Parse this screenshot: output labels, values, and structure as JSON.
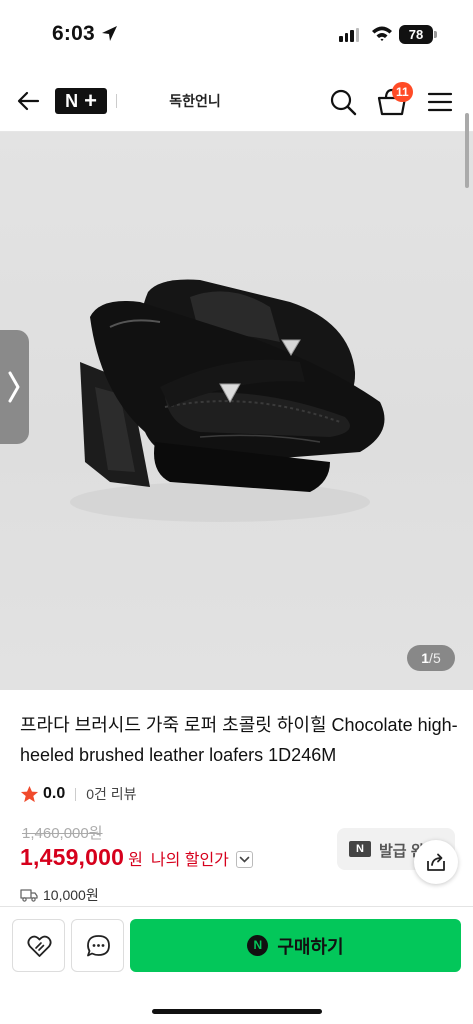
{
  "status_bar": {
    "time": "6:03",
    "battery": "78",
    "icons": [
      "location-arrow-icon",
      "signal-icon",
      "wifi-icon",
      "battery-icon"
    ]
  },
  "nav": {
    "logo": "N",
    "store_name": "독한언니",
    "cart_count": "11",
    "icons": [
      "back-arrow-icon",
      "search-icon",
      "cart-icon",
      "menu-icon"
    ]
  },
  "gallery": {
    "current": "1",
    "separator": "/",
    "total": "5"
  },
  "product": {
    "title": "프라다 브러시드 가죽 로퍼 초콜릿 하이힐 Chocolate high-heeled brushed leather loafers 1D246M",
    "rating": "0.0",
    "review_count": "0건 리뷰",
    "original_price": "1,460,000원",
    "price": "1,459,000",
    "price_unit": "원",
    "my_discount_label": "나의 할인가",
    "shipping_fee": "10,000원"
  },
  "coupon": {
    "icon_text": "N",
    "label": "발급 완료"
  },
  "bottom_bar": {
    "buy_icon": "N",
    "buy_label": "구매하기"
  },
  "colors": {
    "price_red": "#d6001c",
    "buy_green": "#03c75a",
    "badge_orange": "#ff4b26",
    "star_red": "#f04a2c"
  }
}
